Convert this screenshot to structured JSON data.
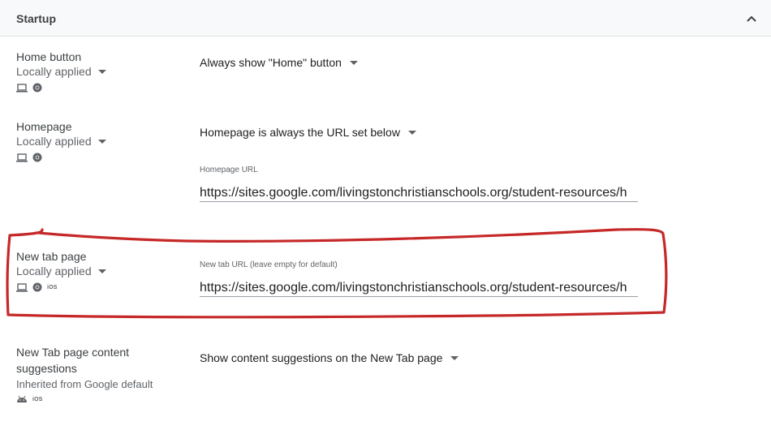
{
  "section": {
    "title": "Startup",
    "collapse_icon": "chevron-up-icon"
  },
  "settings": {
    "home_button": {
      "name": "Home button",
      "scope": "Locally applied",
      "platforms": [
        "laptop-icon",
        "chrome-icon"
      ],
      "value": "Always show \"Home\" button"
    },
    "homepage": {
      "name": "Homepage",
      "scope": "Locally applied",
      "platforms": [
        "laptop-icon",
        "chrome-icon"
      ],
      "value": "Homepage is always the URL set below",
      "url_label": "Homepage URL",
      "url_value": "https://sites.google.com/livingstonchristianschools.org/student-resources/h"
    },
    "new_tab_page": {
      "name": "New tab page",
      "scope": "Locally applied",
      "platforms": [
        "laptop-icon",
        "chrome-icon",
        "ios-icon"
      ],
      "ios_label": "iOS",
      "url_label": "New tab URL (leave empty for default)",
      "url_value": "https://sites.google.com/livingstonchristianschools.org/student-resources/h"
    },
    "new_tab_content": {
      "name": "New Tab page content suggestions",
      "scope": "Inherited from Google default",
      "platforms": [
        "android-icon",
        "ios-icon"
      ],
      "ios_label": "iOS",
      "value": "Show content suggestions on the New Tab page"
    }
  },
  "colors": {
    "header_bg": "#f8f9fa",
    "annotation": "#c62828",
    "text_primary": "#202124",
    "text_secondary": "#5f6368"
  }
}
